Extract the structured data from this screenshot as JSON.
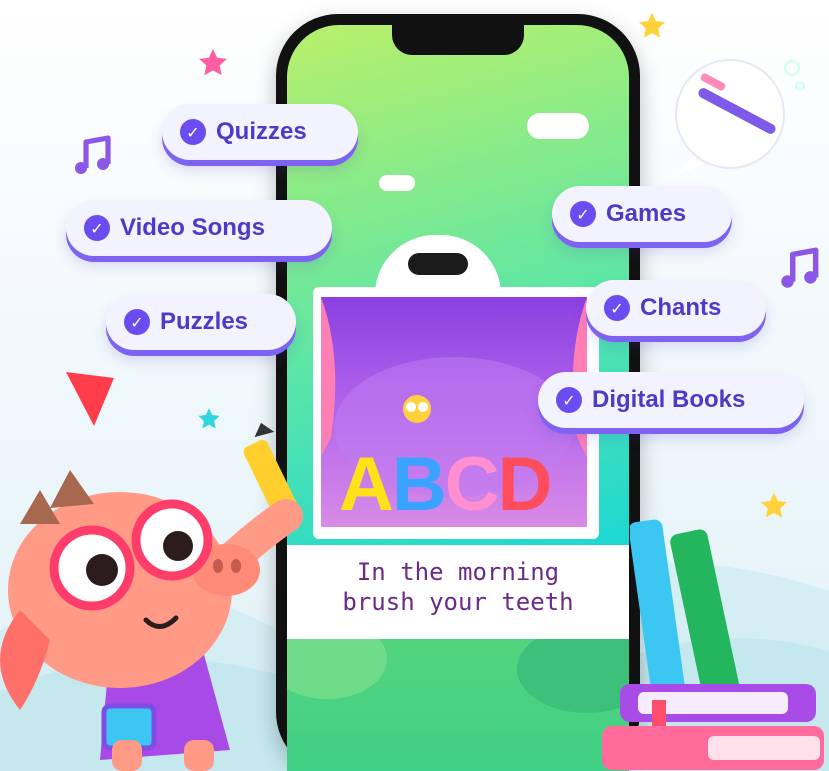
{
  "features": [
    {
      "label": "Quizzes",
      "icon": "check-circle-icon"
    },
    {
      "label": "Video Songs",
      "icon": "check-circle-icon"
    },
    {
      "label": "Puzzles",
      "icon": "check-circle-icon"
    },
    {
      "label": "Games",
      "icon": "check-circle-icon"
    },
    {
      "label": "Chants",
      "icon": "check-circle-icon"
    },
    {
      "label": "Digital Books",
      "icon": "check-circle-icon"
    }
  ],
  "phone": {
    "letters": [
      "A",
      "B",
      "C",
      "D"
    ],
    "letter_colors": [
      "#ffe11a",
      "#3aa3ff",
      "#ff8fd0",
      "#ff4d5e"
    ],
    "caption_line1": "In the morning",
    "caption_line2": "brush your teeth"
  },
  "colors": {
    "pill_bg": "#f3f2ff",
    "pill_text": "#4d3bc8",
    "check_bg": "#6a4cf0",
    "accent_shadow": "#7e63f3"
  },
  "decorations": [
    "music-note-icon",
    "star-icon",
    "toothbrush-icon",
    "crayon-icon",
    "book-stack-icon",
    "pencil-icon",
    "pig-mascot"
  ]
}
